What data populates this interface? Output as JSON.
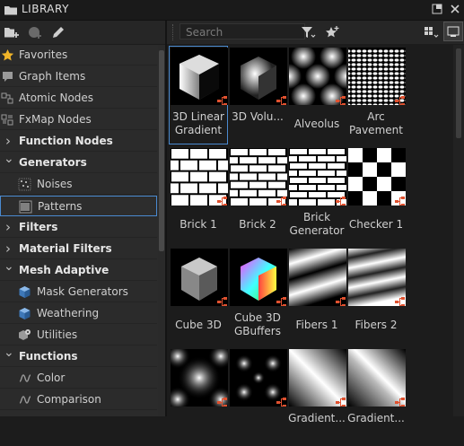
{
  "window": {
    "title": "LIBRARY"
  },
  "toolbar": {
    "search_placeholder": "Search"
  },
  "sidebar": {
    "items": [
      {
        "label": "Favorites",
        "icon": "star-icon",
        "kind": "top",
        "bold": false
      },
      {
        "label": "Graph Items",
        "icon": "comment-icon",
        "kind": "top",
        "bold": false
      },
      {
        "label": "Atomic Nodes",
        "icon": "atomic-node-icon",
        "kind": "top",
        "bold": false
      },
      {
        "label": "FxMap Nodes",
        "icon": "fxmap-icon",
        "kind": "top",
        "bold": false
      },
      {
        "label": "Function Nodes",
        "icon": "chevron-right-icon",
        "kind": "folder",
        "bold": true
      },
      {
        "label": "Generators",
        "icon": "chevron-down-icon",
        "kind": "folder",
        "bold": true
      },
      {
        "label": "Noises",
        "icon": "noise-icon",
        "kind": "sub",
        "bold": false
      },
      {
        "label": "Patterns",
        "icon": "pattern-icon",
        "kind": "sub",
        "bold": false,
        "selected": true
      },
      {
        "label": "Filters",
        "icon": "chevron-right-icon",
        "kind": "folder",
        "bold": true
      },
      {
        "label": "Material Filters",
        "icon": "chevron-right-icon",
        "kind": "folder",
        "bold": true
      },
      {
        "label": "Mesh Adaptive",
        "icon": "chevron-down-icon",
        "kind": "folder",
        "bold": true
      },
      {
        "label": "Mask Generators",
        "icon": "cube-icon",
        "kind": "sub",
        "bold": false
      },
      {
        "label": "Weathering",
        "icon": "cube-icon",
        "kind": "sub",
        "bold": false
      },
      {
        "label": "Utilities",
        "icon": "cube-gear-icon",
        "kind": "sub",
        "bold": false
      },
      {
        "label": "Functions",
        "icon": "chevron-down-icon",
        "kind": "folder",
        "bold": true
      },
      {
        "label": "Color",
        "icon": "function-icon",
        "kind": "sub",
        "bold": false
      },
      {
        "label": "Comparison",
        "icon": "function-icon",
        "kind": "sub",
        "bold": false
      }
    ]
  },
  "grid": {
    "tiles": [
      {
        "name": "3D Linear Gradient",
        "thumb": "linear-gradient-cube",
        "selected": true
      },
      {
        "name": "3D Volu...",
        "thumb": "volume-cube"
      },
      {
        "name": "Alveolus",
        "thumb": "alveolus"
      },
      {
        "name": "Arc Pavement",
        "thumb": "arc-pavement"
      },
      {
        "name": "Brick 1",
        "thumb": "brick"
      },
      {
        "name": "Brick 2",
        "thumb": "brick2"
      },
      {
        "name": "Brick Generator",
        "thumb": "brick3"
      },
      {
        "name": "Checker 1",
        "thumb": "checker"
      },
      {
        "name": "Cube 3D",
        "thumb": "cube3d"
      },
      {
        "name": "Cube 3D GBuffers",
        "thumb": "cube-gbuffers"
      },
      {
        "name": "Fibers 1",
        "thumb": "fibers1"
      },
      {
        "name": "Fibers 2",
        "thumb": "fibers2"
      },
      {
        "name": "",
        "thumb": "blobs"
      },
      {
        "name": "",
        "thumb": "dots"
      },
      {
        "name": "Gradient...",
        "thumb": "diag-gradient"
      },
      {
        "name": "Gradient...",
        "thumb": "diag-gradient2"
      }
    ]
  },
  "colors": {
    "accent": "#4a8ad0",
    "badge": "#e0512f"
  }
}
